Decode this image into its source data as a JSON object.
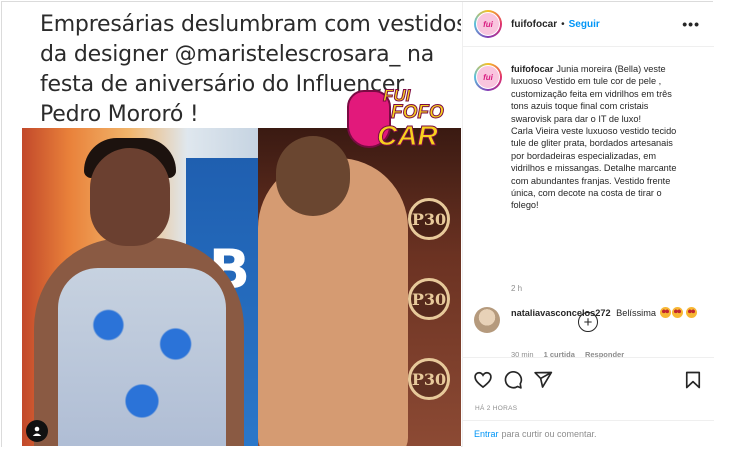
{
  "post_image": {
    "headline_lines": [
      "Empresárias deslumbram com vestidos",
      "da designer @maristelescrosara_  na",
      "festa de aniversário do Influencer",
      "Pedro Mororó !"
    ],
    "sticker": {
      "line1": "FUI",
      "line2": "FOFO",
      "line3": "CAR"
    },
    "left_panel_letter": "B",
    "logo_text": "P30"
  },
  "header": {
    "username": "fuifofocar",
    "separator": "•",
    "follow_label": "Seguir",
    "more_icon": "more-horizontal-icon",
    "avatar_text": "fui"
  },
  "caption": {
    "username": "fuifofocar",
    "lines": [
      "Junia moreira (Bella) veste",
      "luxuoso Vestido em tule cor de pele ,",
      "customização feita em vidrilhos em três",
      "tons azuis toque final com cristais",
      "swarovisk para dar o IT de luxo!",
      "Carla Vieira veste luxuoso vestido tecido",
      "tule de gliter prata, bordados artesanais",
      "por bordadeiras especializadas, em",
      "vidrilhos e missangas. Detalhe marcante",
      "com abundantes franjas. Vestido frente",
      "única, com decote na costa de tirar o",
      "folego!"
    ],
    "time": "2 h",
    "load_more_icon": "plus-circle-icon",
    "load_more_symbol": "+"
  },
  "comment": {
    "username": "nataliavasconcelos272",
    "text": "Belíssima",
    "time": "30 min",
    "likes": "1 curtida",
    "reply": "Responder"
  },
  "actions": {
    "like_icon": "heart-icon",
    "comment_icon": "comment-icon",
    "share_icon": "send-icon",
    "save_icon": "bookmark-icon"
  },
  "post_time": "HÁ 2 HORAS",
  "footer": {
    "login_link": "Entrar",
    "prompt": "para curtir ou comentar."
  }
}
